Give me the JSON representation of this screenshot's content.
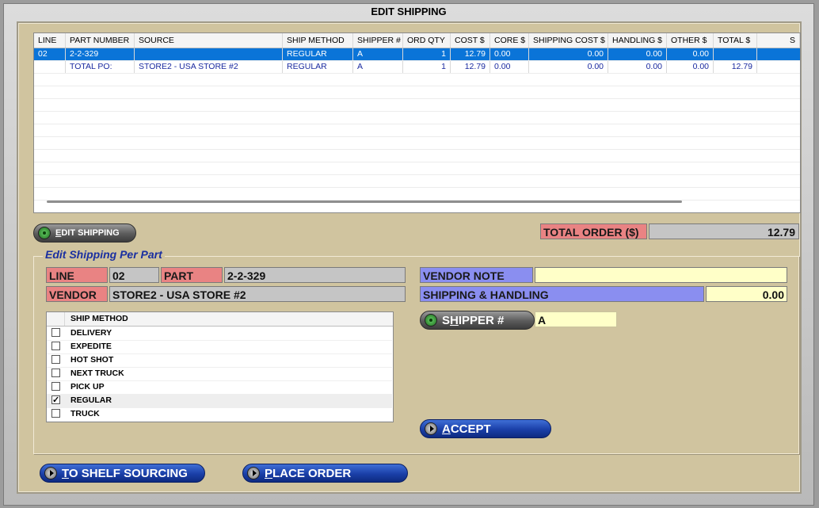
{
  "window": {
    "title": "EDIT SHIPPING"
  },
  "grid": {
    "columns": [
      "LINE",
      "PART NUMBER",
      "SOURCE",
      "SHIP METHOD",
      "SHIPPER #",
      "ORD QTY",
      "COST $",
      "CORE $",
      "SHIPPING COST $",
      "HANDLING $",
      "OTHER $",
      "TOTAL $",
      "S"
    ],
    "rows": [
      {
        "line": "02",
        "part": "2-2-329",
        "source": "",
        "ship_method": "REGULAR",
        "shipper": "A",
        "qty": "1",
        "cost": "12.79",
        "core": "0.00",
        "ship_cost": "0.00",
        "handling": "0.00",
        "other": "0.00",
        "total": "",
        "selected": true
      },
      {
        "line": "",
        "part": "TOTAL PO:",
        "source": "STORE2 - USA STORE #2",
        "ship_method": "REGULAR",
        "shipper": "A",
        "qty": "1",
        "cost": "12.79",
        "core": "0.00",
        "ship_cost": "0.00",
        "handling": "0.00",
        "other": "0.00",
        "total": "12.79",
        "selected": false
      }
    ]
  },
  "edit_shipping_button": {
    "key": "E",
    "rest": "DIT SHIPPING"
  },
  "total_order": {
    "label": "TOTAL ORDER ($)",
    "value": "12.79"
  },
  "group": {
    "title": "Edit Shipping Per Part"
  },
  "fields": {
    "line_label": "LINE",
    "line_value": "02",
    "part_label": "PART",
    "part_value": "2-2-329",
    "vendor_label": "VENDOR",
    "vendor_value": "STORE2 - USA STORE #2",
    "vendor_note_label": "VENDOR NOTE",
    "vendor_note_value": "",
    "sh_label": "SHIPPING & HANDLING",
    "sh_value": "0.00",
    "shipper_value": "A"
  },
  "shipper_button": {
    "pre": "S",
    "key": "H",
    "rest": "IPPER #"
  },
  "ship_methods": {
    "header": "SHIP METHOD",
    "items": [
      {
        "label": "DELIVERY",
        "checked": false
      },
      {
        "label": "EXPEDITE",
        "checked": false
      },
      {
        "label": "HOT SHOT",
        "checked": false
      },
      {
        "label": "NEXT TRUCK",
        "checked": false
      },
      {
        "label": "PICK UP",
        "checked": false
      },
      {
        "label": "REGULAR",
        "checked": true
      },
      {
        "label": "TRUCK",
        "checked": false
      }
    ]
  },
  "accept_button": {
    "key": "A",
    "rest": "CCEPT"
  },
  "shelf_button": {
    "key": "T",
    "rest": "O SHELF SOURCING"
  },
  "place_order_button": {
    "key": "P",
    "rest": "LACE ORDER"
  },
  "colors": {
    "panel": "#d0c49f",
    "selected_row": "#0a74d8",
    "label_red": "#e98383",
    "label_blue": "#8a8ef0"
  }
}
